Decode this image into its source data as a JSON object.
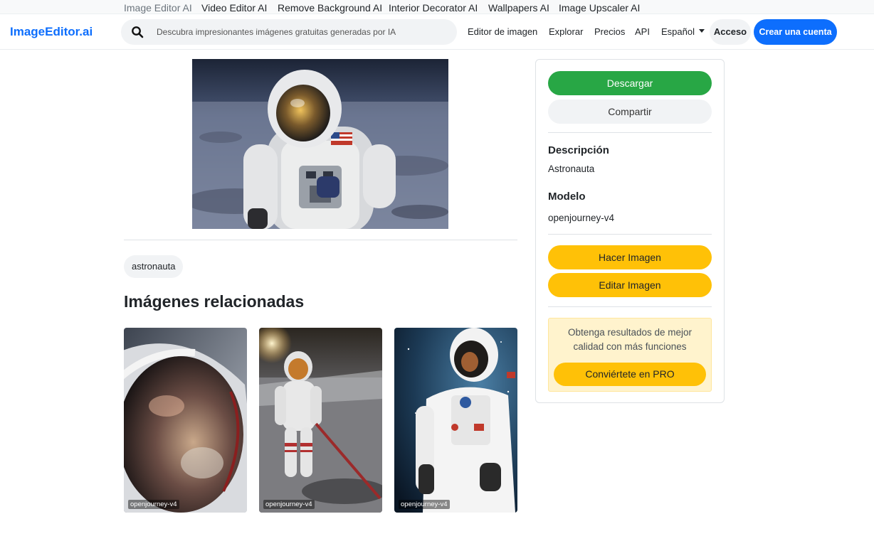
{
  "tools_bar": {
    "items": [
      "Image Editor AI",
      "Video Editor AI",
      "Remove Background AI",
      "Interior Decorator AI",
      "Wallpapers AI",
      "Image Upscaler AI"
    ]
  },
  "navbar": {
    "brand": "ImageEditor.ai",
    "search_placeholder": "Descubra impresionantes imágenes gratuitas generadas por IA",
    "links": [
      "Editor de imagen",
      "Explorar",
      "Precios",
      "API"
    ],
    "language": "Español",
    "login": "Acceso",
    "signup": "Crear una cuenta"
  },
  "image": {
    "tag": "astronauta"
  },
  "related": {
    "title": "Imágenes relacionadas",
    "items": [
      {
        "label": "openjourney-v4"
      },
      {
        "label": "openjourney-v4"
      },
      {
        "label": "openjourney-v4"
      }
    ]
  },
  "side": {
    "download": "Descargar",
    "share": "Compartir",
    "description_label": "Descripción",
    "description_value": "Astronauta",
    "model_label": "Modelo",
    "model_value": "openjourney-v4",
    "make_image": "Hacer Imagen",
    "edit_image": "Editar Imagen",
    "pro_text": "Obtenga resultados de mejor calidad con más funciones",
    "pro_button": "Conviértete en PRO"
  },
  "colors": {
    "brand": "#0d6efd",
    "download": "#28a745",
    "accent_yellow": "#ffc107",
    "pro_bg": "#fff3cd"
  }
}
